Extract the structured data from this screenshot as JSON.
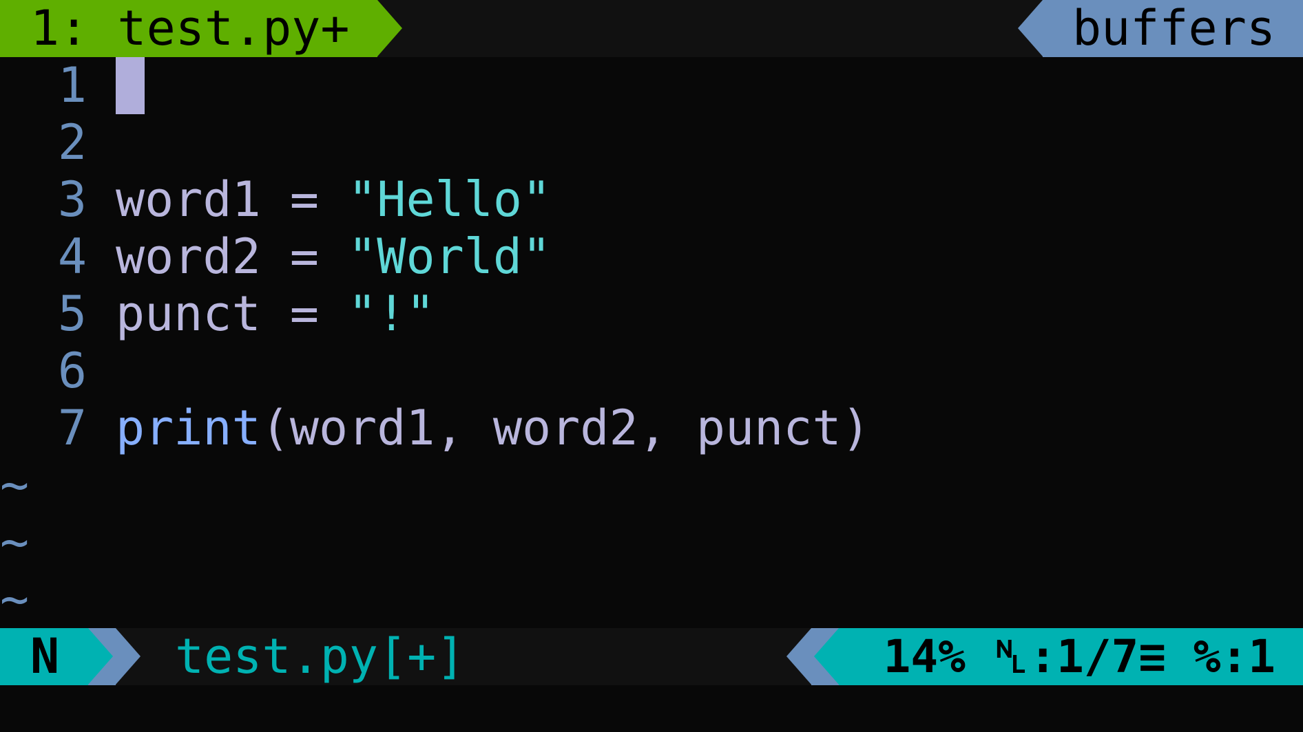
{
  "tabline": {
    "active_tab": "1: test.py+",
    "right_label": "buffers"
  },
  "editor": {
    "lines": [
      {
        "number": "1",
        "tokens": []
      },
      {
        "number": "2",
        "tokens": []
      },
      {
        "number": "3",
        "tokens": [
          {
            "text": "word1 = ",
            "kind": "ident"
          },
          {
            "text": "\"Hello\"",
            "kind": "str"
          }
        ]
      },
      {
        "number": "4",
        "tokens": [
          {
            "text": "word2 = ",
            "kind": "ident"
          },
          {
            "text": "\"World\"",
            "kind": "str"
          }
        ]
      },
      {
        "number": "5",
        "tokens": [
          {
            "text": "punct = ",
            "kind": "ident"
          },
          {
            "text": "\"!\"",
            "kind": "str"
          }
        ]
      },
      {
        "number": "6",
        "tokens": []
      },
      {
        "number": "7",
        "tokens": [
          {
            "text": "print",
            "kind": "func"
          },
          {
            "text": "(word1, word2, punct)",
            "kind": "ident"
          }
        ]
      }
    ],
    "filler": [
      "~",
      "~",
      "~"
    ]
  },
  "statusline": {
    "mode": "N",
    "filename": "test.py[+]",
    "position": "14% ␤:1/7≡ %:1"
  },
  "colors": {
    "background": "#080808",
    "tab_active": "#5faf00",
    "accent_blue": "#6a8fbd",
    "accent_cyan": "#00b2b2",
    "string": "#5fd7d7",
    "identifier": "#b9b6dd",
    "function": "#87afff",
    "cursor": "#b0aedb"
  }
}
